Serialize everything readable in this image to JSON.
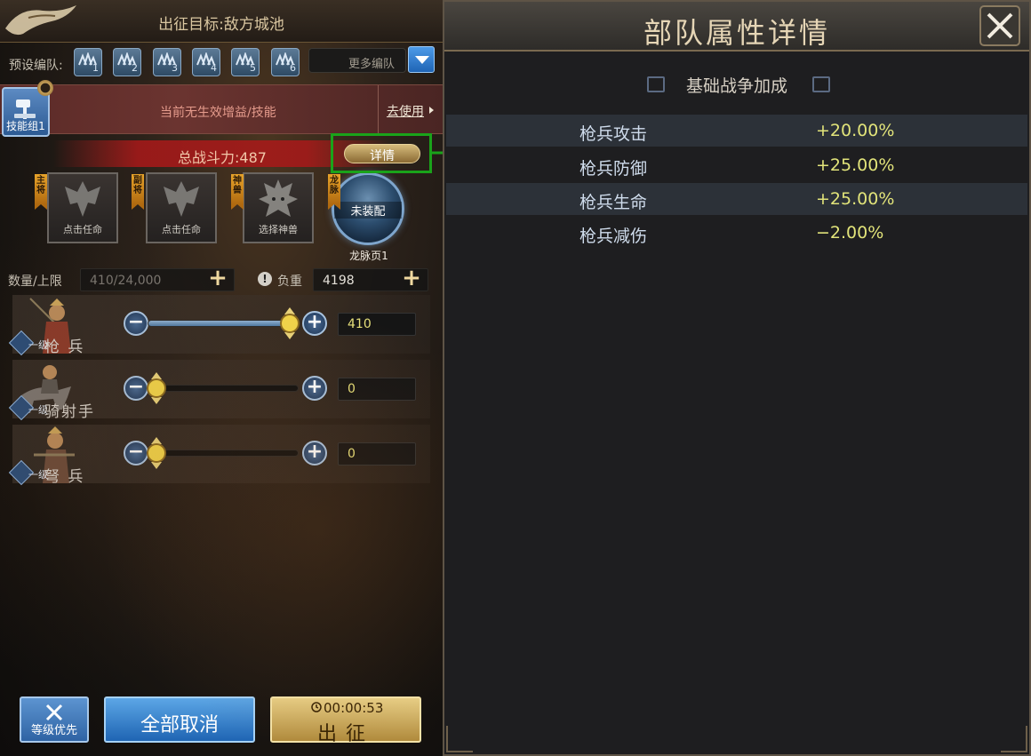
{
  "header": {
    "target": "出征目标:敌方城池"
  },
  "presets": {
    "label": "预设编队:",
    "items": [
      "1",
      "2",
      "3",
      "4",
      "5",
      "6"
    ],
    "more_label": "更多编队"
  },
  "skill_bar": {
    "group_label": "技能组1",
    "status_text": "当前无生效增益/技能",
    "action_label": "去使用"
  },
  "power": {
    "text": "总战斗力:487",
    "detail_label": "详情"
  },
  "slots": {
    "main_general": {
      "ribbon": "主将",
      "label": "点击任命"
    },
    "vice_general": {
      "ribbon": "副将",
      "label": "点击任命"
    },
    "beast": {
      "ribbon": "神兽",
      "label": "选择神兽"
    },
    "dragon": {
      "ribbon": "龙脉",
      "center_label": "未装配",
      "label": "龙脉页1"
    }
  },
  "capacity": {
    "qty_label": "数量/上限",
    "qty_value": "410/24,000",
    "load_label": "负重",
    "load_value": "4198"
  },
  "troops": [
    {
      "level": "一级",
      "name": "枪 兵",
      "value": "410",
      "fill_fraction": 1.0
    },
    {
      "level": "一级",
      "name": "骑射手",
      "value": "0",
      "fill_fraction": 0.0
    },
    {
      "level": "一级",
      "name": "弩 兵",
      "value": "0",
      "fill_fraction": 0.0
    }
  ],
  "buttons": {
    "level_priority": "等级优先",
    "cancel_all": "全部取消",
    "timer": "00:00:53",
    "march": "出征"
  },
  "detail_panel": {
    "title": "部队属性详情",
    "section": "基础战争加成",
    "rows": [
      {
        "name": "枪兵攻击",
        "value": "+20.00%"
      },
      {
        "name": "枪兵防御",
        "value": "+25.00%"
      },
      {
        "name": "枪兵生命",
        "value": "+25.00%"
      },
      {
        "name": "枪兵减伤",
        "value": "−2.00%"
      }
    ]
  },
  "colors": {
    "highlight": "#1aa31a",
    "value_yellow": "#e2e47a",
    "accent_blue": "#2f63a4",
    "gold": "#b08a3c"
  }
}
